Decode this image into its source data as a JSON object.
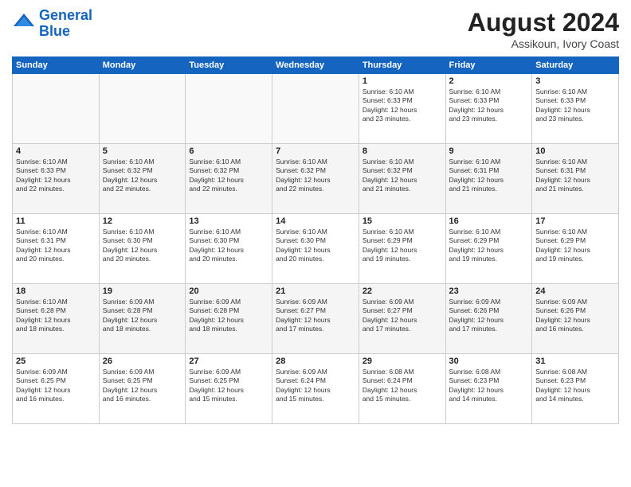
{
  "header": {
    "logo_line1": "General",
    "logo_line2": "Blue",
    "month_year": "August 2024",
    "location": "Assikoun, Ivory Coast"
  },
  "weekdays": [
    "Sunday",
    "Monday",
    "Tuesday",
    "Wednesday",
    "Thursday",
    "Friday",
    "Saturday"
  ],
  "weeks": [
    [
      {
        "day": "",
        "info": ""
      },
      {
        "day": "",
        "info": ""
      },
      {
        "day": "",
        "info": ""
      },
      {
        "day": "",
        "info": ""
      },
      {
        "day": "1",
        "info": "Sunrise: 6:10 AM\nSunset: 6:33 PM\nDaylight: 12 hours\nand 23 minutes."
      },
      {
        "day": "2",
        "info": "Sunrise: 6:10 AM\nSunset: 6:33 PM\nDaylight: 12 hours\nand 23 minutes."
      },
      {
        "day": "3",
        "info": "Sunrise: 6:10 AM\nSunset: 6:33 PM\nDaylight: 12 hours\nand 23 minutes."
      }
    ],
    [
      {
        "day": "4",
        "info": "Sunrise: 6:10 AM\nSunset: 6:33 PM\nDaylight: 12 hours\nand 22 minutes."
      },
      {
        "day": "5",
        "info": "Sunrise: 6:10 AM\nSunset: 6:32 PM\nDaylight: 12 hours\nand 22 minutes."
      },
      {
        "day": "6",
        "info": "Sunrise: 6:10 AM\nSunset: 6:32 PM\nDaylight: 12 hours\nand 22 minutes."
      },
      {
        "day": "7",
        "info": "Sunrise: 6:10 AM\nSunset: 6:32 PM\nDaylight: 12 hours\nand 22 minutes."
      },
      {
        "day": "8",
        "info": "Sunrise: 6:10 AM\nSunset: 6:32 PM\nDaylight: 12 hours\nand 21 minutes."
      },
      {
        "day": "9",
        "info": "Sunrise: 6:10 AM\nSunset: 6:31 PM\nDaylight: 12 hours\nand 21 minutes."
      },
      {
        "day": "10",
        "info": "Sunrise: 6:10 AM\nSunset: 6:31 PM\nDaylight: 12 hours\nand 21 minutes."
      }
    ],
    [
      {
        "day": "11",
        "info": "Sunrise: 6:10 AM\nSunset: 6:31 PM\nDaylight: 12 hours\nand 20 minutes."
      },
      {
        "day": "12",
        "info": "Sunrise: 6:10 AM\nSunset: 6:30 PM\nDaylight: 12 hours\nand 20 minutes."
      },
      {
        "day": "13",
        "info": "Sunrise: 6:10 AM\nSunset: 6:30 PM\nDaylight: 12 hours\nand 20 minutes."
      },
      {
        "day": "14",
        "info": "Sunrise: 6:10 AM\nSunset: 6:30 PM\nDaylight: 12 hours\nand 20 minutes."
      },
      {
        "day": "15",
        "info": "Sunrise: 6:10 AM\nSunset: 6:29 PM\nDaylight: 12 hours\nand 19 minutes."
      },
      {
        "day": "16",
        "info": "Sunrise: 6:10 AM\nSunset: 6:29 PM\nDaylight: 12 hours\nand 19 minutes."
      },
      {
        "day": "17",
        "info": "Sunrise: 6:10 AM\nSunset: 6:29 PM\nDaylight: 12 hours\nand 19 minutes."
      }
    ],
    [
      {
        "day": "18",
        "info": "Sunrise: 6:10 AM\nSunset: 6:28 PM\nDaylight: 12 hours\nand 18 minutes."
      },
      {
        "day": "19",
        "info": "Sunrise: 6:09 AM\nSunset: 6:28 PM\nDaylight: 12 hours\nand 18 minutes."
      },
      {
        "day": "20",
        "info": "Sunrise: 6:09 AM\nSunset: 6:28 PM\nDaylight: 12 hours\nand 18 minutes."
      },
      {
        "day": "21",
        "info": "Sunrise: 6:09 AM\nSunset: 6:27 PM\nDaylight: 12 hours\nand 17 minutes."
      },
      {
        "day": "22",
        "info": "Sunrise: 6:09 AM\nSunset: 6:27 PM\nDaylight: 12 hours\nand 17 minutes."
      },
      {
        "day": "23",
        "info": "Sunrise: 6:09 AM\nSunset: 6:26 PM\nDaylight: 12 hours\nand 17 minutes."
      },
      {
        "day": "24",
        "info": "Sunrise: 6:09 AM\nSunset: 6:26 PM\nDaylight: 12 hours\nand 16 minutes."
      }
    ],
    [
      {
        "day": "25",
        "info": "Sunrise: 6:09 AM\nSunset: 6:25 PM\nDaylight: 12 hours\nand 16 minutes."
      },
      {
        "day": "26",
        "info": "Sunrise: 6:09 AM\nSunset: 6:25 PM\nDaylight: 12 hours\nand 16 minutes."
      },
      {
        "day": "27",
        "info": "Sunrise: 6:09 AM\nSunset: 6:25 PM\nDaylight: 12 hours\nand 15 minutes."
      },
      {
        "day": "28",
        "info": "Sunrise: 6:09 AM\nSunset: 6:24 PM\nDaylight: 12 hours\nand 15 minutes."
      },
      {
        "day": "29",
        "info": "Sunrise: 6:08 AM\nSunset: 6:24 PM\nDaylight: 12 hours\nand 15 minutes."
      },
      {
        "day": "30",
        "info": "Sunrise: 6:08 AM\nSunset: 6:23 PM\nDaylight: 12 hours\nand 14 minutes."
      },
      {
        "day": "31",
        "info": "Sunrise: 6:08 AM\nSunset: 6:23 PM\nDaylight: 12 hours\nand 14 minutes."
      }
    ]
  ]
}
